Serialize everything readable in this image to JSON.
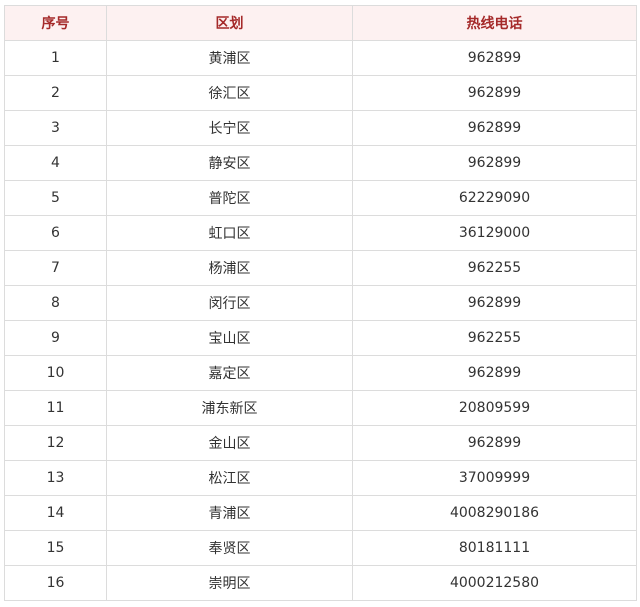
{
  "table": {
    "headers": [
      "序号",
      "区划",
      "热线电话"
    ],
    "rows": [
      [
        "1",
        "黄浦区",
        "962899"
      ],
      [
        "2",
        "徐汇区",
        "962899"
      ],
      [
        "3",
        "长宁区",
        "962899"
      ],
      [
        "4",
        "静安区",
        "962899"
      ],
      [
        "5",
        "普陀区",
        "62229090"
      ],
      [
        "6",
        "虹口区",
        "36129000"
      ],
      [
        "7",
        "杨浦区",
        "962255"
      ],
      [
        "8",
        "闵行区",
        "962899"
      ],
      [
        "9",
        "宝山区",
        "962255"
      ],
      [
        "10",
        "嘉定区",
        "962899"
      ],
      [
        "11",
        "浦东新区",
        "20809599"
      ],
      [
        "12",
        "金山区",
        "962899"
      ],
      [
        "13",
        "松江区",
        "37009999"
      ],
      [
        "14",
        "青浦区",
        "4008290186"
      ],
      [
        "15",
        "奉贤区",
        "80181111"
      ],
      [
        "16",
        "崇明区",
        "4000212580"
      ]
    ]
  },
  "colors": {
    "header_background": "#fdf1f1",
    "header_text": "#a52a2a",
    "border": "#dcdcdc",
    "body_text": "#333333"
  }
}
